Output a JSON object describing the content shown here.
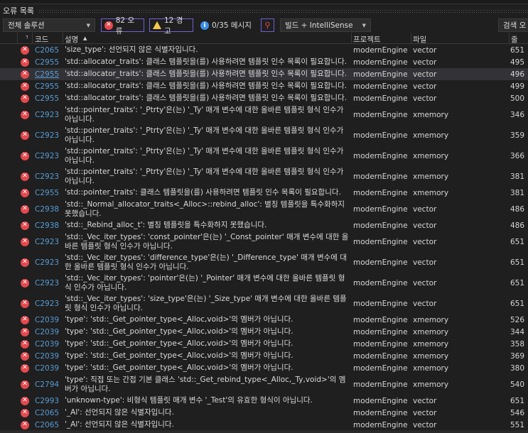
{
  "panel": {
    "title": "오류 목록"
  },
  "toolbar": {
    "scope": "전체 솔루션",
    "errors": "82 오류",
    "warnings": "12 경고",
    "messages": "0/35 메시지",
    "build_filter": "빌드 + IntelliSense",
    "search": "검색 오"
  },
  "columns": {
    "code": "코드",
    "description": "설명",
    "project": "프로젝트",
    "file": "파일",
    "line": "줄"
  },
  "colors": {
    "error": "#e5484d",
    "code_link": "#569cd6",
    "accent_border": "#6f5fd6"
  },
  "rows": [
    {
      "code": "C2065",
      "desc": "'size_type': 선언되지 않은 식별자입니다.",
      "project": "modernEngine",
      "file": "vector",
      "line": "651"
    },
    {
      "code": "C2955",
      "desc": "'std::allocator_traits': 클래스 템플릿을(를) 사용하려면 템플릿 인수 목록이 필요합니다.",
      "project": "modernEngine",
      "file": "vector",
      "line": "495"
    },
    {
      "code": "C2955",
      "desc": "'std::allocator_traits': 클래스 템플릿을(를) 사용하려면 템플릿 인수 목록이 필요합니다.",
      "project": "modernEngine",
      "file": "vector",
      "line": "496",
      "selected": true
    },
    {
      "code": "C2955",
      "desc": "'std::allocator_traits': 클래스 템플릿을(를) 사용하려면 템플릿 인수 목록이 필요합니다.",
      "project": "modernEngine",
      "file": "vector",
      "line": "499"
    },
    {
      "code": "C2955",
      "desc": "'std::allocator_traits': 클래스 템플릿을(를) 사용하려면 템플릿 인수 목록이 필요합니다.",
      "project": "modernEngine",
      "file": "vector",
      "line": "500"
    },
    {
      "code": "C2923",
      "desc": "'std::pointer_traits': '_Ptrty'은(는) '_Ty' 매개 변수에 대한 올바른 템플릿 형식 인수가 아닙니다.",
      "project": "modernEngine",
      "file": "xmemory",
      "line": "346",
      "double": true
    },
    {
      "code": "C2923",
      "desc": "'std::pointer_traits': '_Ptrty'은(는) '_Ty' 매개 변수에 대한 올바른 템플릿 형식 인수가 아닙니다.",
      "project": "modernEngine",
      "file": "xmemory",
      "line": "359",
      "double": true
    },
    {
      "code": "C2923",
      "desc": "'std::pointer_traits': '_Ptrty'은(는) '_Ty' 매개 변수에 대한 올바른 템플릿 형식 인수가 아닙니다.",
      "project": "modernEngine",
      "file": "xmemory",
      "line": "366",
      "double": true
    },
    {
      "code": "C2923",
      "desc": "'std::pointer_traits': '_Ptrty'은(는) '_Ty' 매개 변수에 대한 올바른 템플릿 형식 인수가 아닙니다.",
      "project": "modernEngine",
      "file": "xmemory",
      "line": "381",
      "double": true
    },
    {
      "code": "C2955",
      "desc": "'std::pointer_traits': 클래스 템플릿을(를) 사용하려면 템플릿 인수 목록이 필요합니다.",
      "project": "modernEngine",
      "file": "xmemory",
      "line": "381"
    },
    {
      "code": "C2938",
      "desc": "'std::_Normal_allocator_traits<_Alloc>::rebind_alloc': 별칭 템플릿을 특수화하지 못했습니다.",
      "project": "modernEngine",
      "file": "vector",
      "line": "486",
      "double": true
    },
    {
      "code": "C2938",
      "desc": "'std::_Rebind_alloc_t': 별칭 템플릿을 특수화하지 못했습니다.",
      "project": "modernEngine",
      "file": "vector",
      "line": "486"
    },
    {
      "code": "C2923",
      "desc": "'std::_Vec_iter_types': 'const_pointer'은(는) '_Const_pointer' 매개 변수에 대한 올바른 템플릿 형식 인수가 아닙니다.",
      "project": "modernEngine",
      "file": "vector",
      "line": "651",
      "double": true
    },
    {
      "code": "C2923",
      "desc": "'std::_Vec_iter_types': 'difference_type'은(는) '_Difference_type' 매개 변수에 대한 올바른 템플릿 형식 인수가 아닙니다.",
      "project": "modernEngine",
      "file": "vector",
      "line": "651",
      "double": true
    },
    {
      "code": "C2923",
      "desc": "'std::_Vec_iter_types': 'pointer'은(는) '_Pointer' 매개 변수에 대한 올바른 템플릿 형식 인수가 아닙니다.",
      "project": "modernEngine",
      "file": "vector",
      "line": "651",
      "double": true
    },
    {
      "code": "C2923",
      "desc": "'std::_Vec_iter_types': 'size_type'은(는) '_Size_type' 매개 변수에 대한 올바른 템플릿 형식 인수가 아닙니다.",
      "project": "modernEngine",
      "file": "vector",
      "line": "651",
      "double": true
    },
    {
      "code": "C2039",
      "desc": "'type': 'std::_Get_pointer_type<_Alloc,void>'의 멤버가 아닙니다.",
      "project": "modernEngine",
      "file": "xmemory",
      "line": "526"
    },
    {
      "code": "C2039",
      "desc": "'type': 'std::_Get_pointer_type<_Alloc,void>'의 멤버가 아닙니다.",
      "project": "modernEngine",
      "file": "xmemory",
      "line": "344"
    },
    {
      "code": "C2039",
      "desc": "'type': 'std::_Get_pointer_type<_Alloc,void>'의 멤버가 아닙니다.",
      "project": "modernEngine",
      "file": "xmemory",
      "line": "358"
    },
    {
      "code": "C2039",
      "desc": "'type': 'std::_Get_pointer_type<_Alloc,void>'의 멤버가 아닙니다.",
      "project": "modernEngine",
      "file": "xmemory",
      "line": "369"
    },
    {
      "code": "C2039",
      "desc": "'type': 'std::_Get_pointer_type<_Alloc,void>'의 멤버가 아닙니다.",
      "project": "modernEngine",
      "file": "xmemory",
      "line": "380"
    },
    {
      "code": "C2794",
      "desc": "'type': 직접 또는 간접 기본 클래스 'std::_Get_rebind_type<_Alloc,_Ty,void>'의 멤버가 아닙니다.",
      "project": "modernEngine",
      "file": "xmemory",
      "line": "540",
      "double": true
    },
    {
      "code": "C2993",
      "desc": "'unknown-type': 비형식 템플릿 매개 변수 '_Test'의 유효한 형식이 아닙니다.",
      "project": "modernEngine",
      "file": "vector",
      "line": "651"
    },
    {
      "code": "C2065",
      "desc": "'_Al': 선언되지 않은 식별자입니다.",
      "project": "modernEngine",
      "file": "vector",
      "line": "546"
    },
    {
      "code": "C2065",
      "desc": "'_Al': 선언되지 않은 식별자입니다.",
      "project": "modernEngine",
      "file": "vector",
      "line": "551"
    }
  ]
}
